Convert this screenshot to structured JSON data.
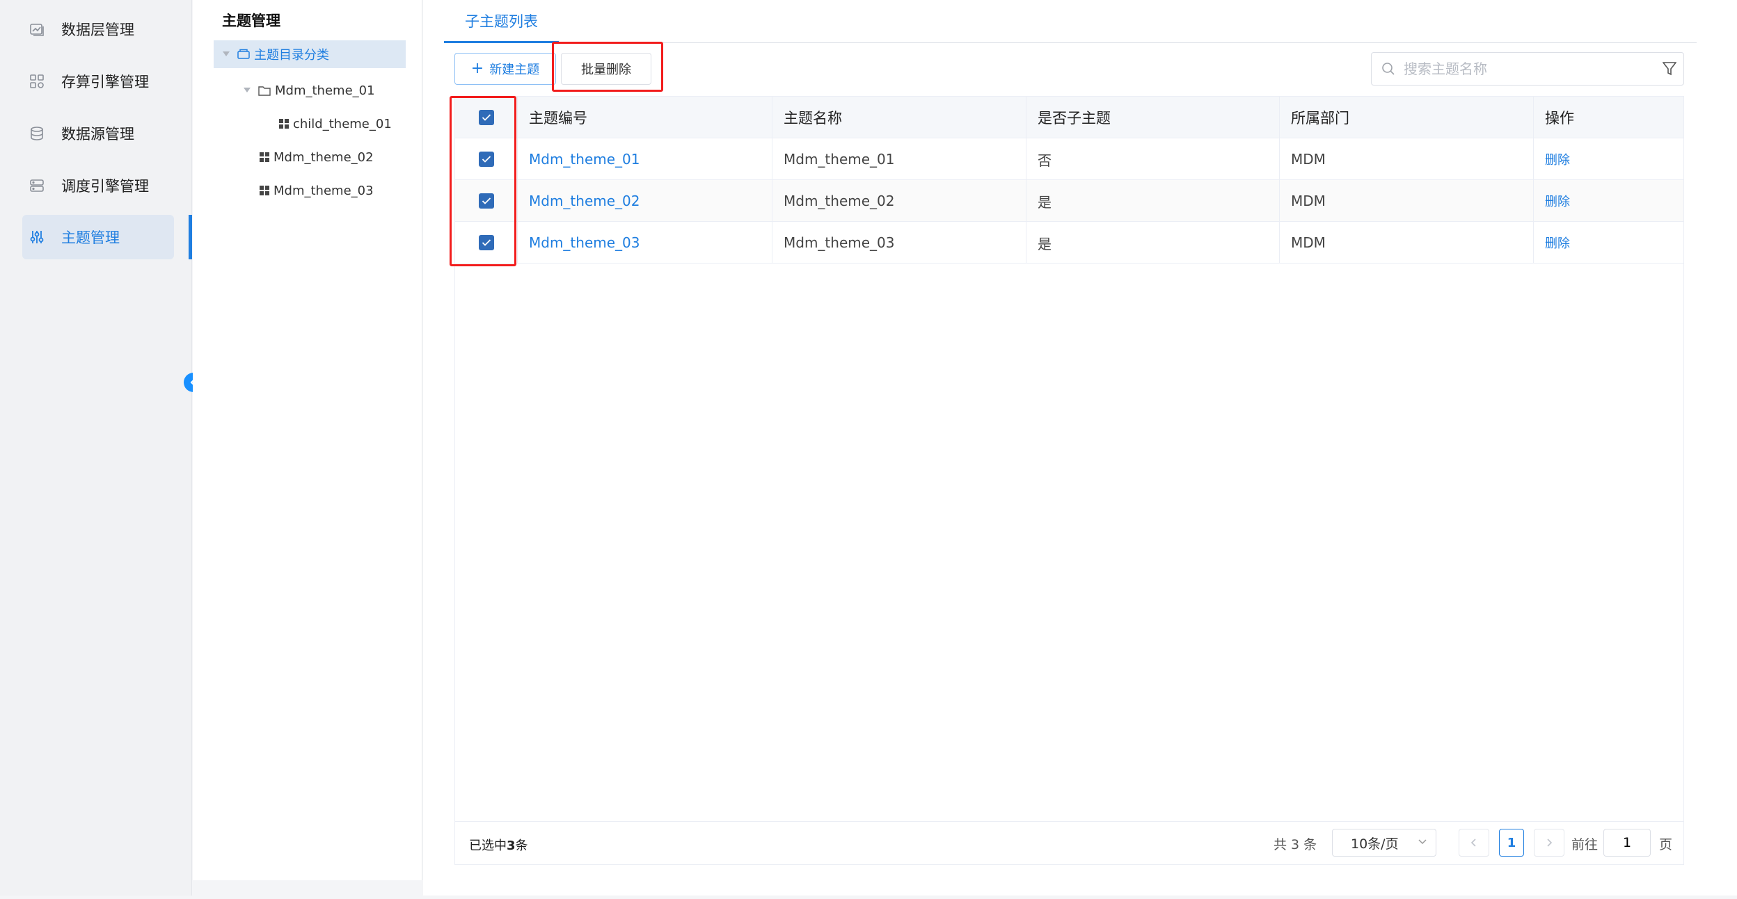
{
  "nav": {
    "items": [
      {
        "label": "数据层管理",
        "icon": "data-layer-icon"
      },
      {
        "label": "存算引擎管理",
        "icon": "engine-grid-icon"
      },
      {
        "label": "数据源管理",
        "icon": "database-icon"
      },
      {
        "label": "调度引擎管理",
        "icon": "server-icon"
      },
      {
        "label": "主题管理",
        "icon": "sliders-icon",
        "active": true
      }
    ]
  },
  "tree": {
    "title": "主题管理",
    "root": "主题目录分类",
    "nodes": [
      "Mdm_theme_01",
      "child_theme_01",
      "Mdm_theme_02",
      "Mdm_theme_03"
    ]
  },
  "main": {
    "tab": "子主题列表",
    "new_button": "新建主题",
    "batch_delete_button": "批量删除",
    "search_placeholder": "搜索主题名称",
    "columns": [
      "主题编号",
      "主题名称",
      "是否子主题",
      "所属部门",
      "操作"
    ],
    "rows": [
      {
        "code": "Mdm_theme_01",
        "name": "Mdm_theme_01",
        "is_sub": "否",
        "dept": "MDM",
        "op": "删除",
        "checked": true
      },
      {
        "code": "Mdm_theme_02",
        "name": "Mdm_theme_02",
        "is_sub": "是",
        "dept": "MDM",
        "op": "删除",
        "checked": true
      },
      {
        "code": "Mdm_theme_03",
        "name": "Mdm_theme_03",
        "is_sub": "是",
        "dept": "MDM",
        "op": "删除",
        "checked": true
      }
    ],
    "footer": {
      "selected_prefix": "已选中",
      "selected_count": "3",
      "selected_suffix": "条",
      "total": "共 3 条",
      "page_size": "10条/页",
      "current_page": "1",
      "goto_label": "前往",
      "goto_value": "1",
      "goto_suffix": "页"
    }
  },
  "colors": {
    "accent": "#1f7ee0",
    "checkbox": "#2f6bb8",
    "highlight": "#f21d1d"
  }
}
